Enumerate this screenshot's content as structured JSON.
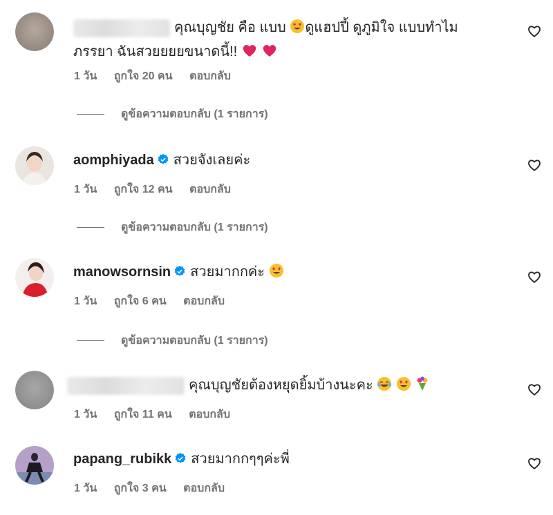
{
  "comments": [
    {
      "username": "",
      "text_line1": "คุณบุญชัย คือ แบบ",
      "text_line1b": "ดูแฮปปี้ ดูภูมิใจ แบบทำไม",
      "text_line2": "ภรรยา ฉันสวยยยยขนาดนี้!!",
      "time": "1 วัน",
      "likes": "ถูกใจ 20 คน",
      "reply": "ตอบกลับ",
      "view_replies": "ดูข้อความตอบกลับ (1 รายการ)"
    },
    {
      "username": "aomphiyada",
      "text": "สวยจังเลยค่ะ",
      "time": "1 วัน",
      "likes": "ถูกใจ 12 คน",
      "reply": "ตอบกลับ",
      "view_replies": "ดูข้อความตอบกลับ (1 รายการ)"
    },
    {
      "username": "manowsornsin",
      "text": "สวยมากกค่ะ",
      "time": "1 วัน",
      "likes": "ถูกใจ 6 คน",
      "reply": "ตอบกลับ",
      "view_replies": "ดูข้อความตอบกลับ (1 รายการ)"
    },
    {
      "username": "",
      "text": "คุณบุญชัยต้องหยุดยิ้มบ้างนะคะ",
      "time": "1 วัน",
      "likes": "ถูกใจ 11 คน",
      "reply": "ตอบกลับ"
    },
    {
      "username": "papang_rubikk",
      "text": "สวยมากกๆๆค่ะพี่",
      "time": "1 วัน",
      "likes": "ถูกใจ 3 คน",
      "reply": "ตอบกลับ"
    }
  ],
  "colors": {
    "text": "#262626",
    "meta": "#737373",
    "verified": "#0095f6",
    "heart_red": "#e0245e"
  },
  "icons": {
    "like": "heart-outline-icon",
    "verified": "verified-badge-icon"
  }
}
